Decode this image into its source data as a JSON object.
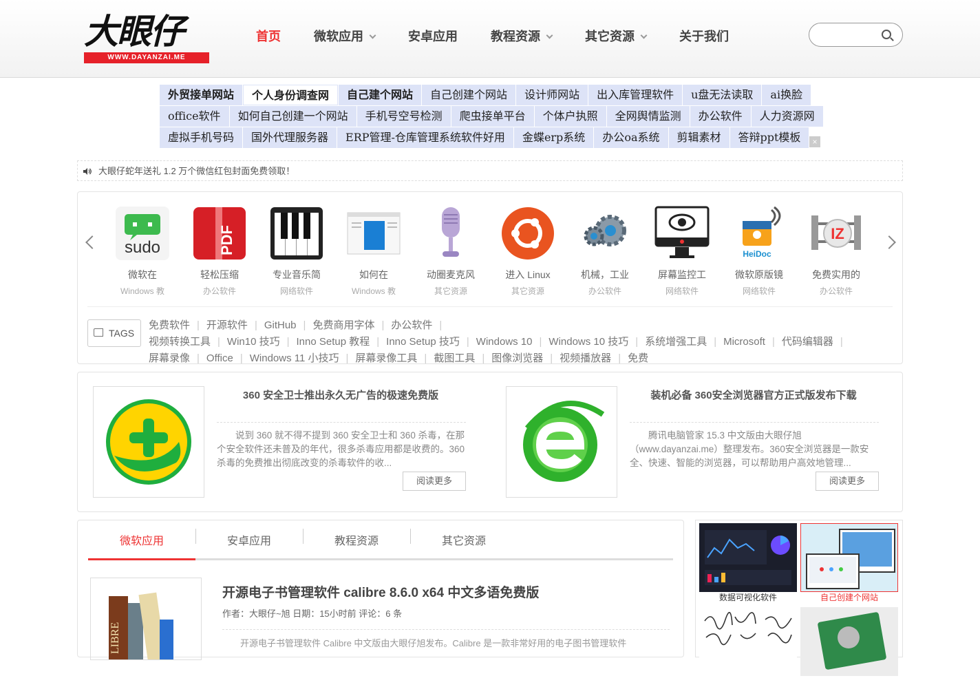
{
  "header": {
    "logo_text": "大眼仔",
    "logo_url_text": "WWW.DAYANZAI.ME",
    "nav": [
      {
        "label": "首页",
        "active": true,
        "has_menu": false
      },
      {
        "label": "微软应用",
        "active": false,
        "has_menu": true
      },
      {
        "label": "安卓应用",
        "active": false,
        "has_menu": false
      },
      {
        "label": "教程资源",
        "active": false,
        "has_menu": true
      },
      {
        "label": "其它资源",
        "active": false,
        "has_menu": true
      },
      {
        "label": "关于我们",
        "active": false,
        "has_menu": false
      }
    ],
    "search_placeholder": ""
  },
  "ad_links": {
    "rows": [
      [
        "外贸接单网站",
        "个人身份调查网",
        "自己建个网站",
        "自己创建个网站",
        "设计师网站",
        "出入库管理软件",
        "u盘无法读取",
        "ai换脸"
      ],
      [
        "office软件",
        "如何自己创建一个网站",
        "手机号空号检测",
        "爬虫接单平台",
        "个体户执照",
        "全网舆情监测",
        "办公软件",
        "人力资源网"
      ],
      [
        "虚拟手机号码",
        "国外代理服务器",
        "ERP管理-仓库管理系统软件好用",
        "金蝶erp系统",
        "办公oa系统",
        "剪辑素材",
        "答辩ppt模板"
      ]
    ],
    "close": "×"
  },
  "notice": {
    "text": "大眼仔蛇年送礼 1.2 万个微信红包封面免费领取！"
  },
  "apps": [
    {
      "title": "微软在",
      "sub": "Windows 教",
      "icon": "sudo-icon"
    },
    {
      "title": "轻松压缩",
      "sub": "办公软件",
      "icon": "pdf-zip-icon"
    },
    {
      "title": "专业音乐简",
      "sub": "网络软件",
      "icon": "piano-icon"
    },
    {
      "title": "如何在",
      "sub": "Windows 教",
      "icon": "window-icon"
    },
    {
      "title": "动圈麦克风",
      "sub": "其它资源",
      "icon": "microphone-icon"
    },
    {
      "title": "进入 Linux",
      "sub": "其它资源",
      "icon": "ubuntu-icon"
    },
    {
      "title": "机械，工业",
      "sub": "办公软件",
      "icon": "gears-icon"
    },
    {
      "title": "屏幕监控工",
      "sub": "网络软件",
      "icon": "monitor-eye-icon"
    },
    {
      "title": "微软原版镜",
      "sub": "网络软件",
      "icon": "heidoc-icon"
    },
    {
      "title": "免费实用的",
      "sub": "办公软件",
      "icon": "izarc-icon"
    }
  ],
  "tags": {
    "label": "TAGS",
    "items": [
      "免费软件",
      "开源软件",
      "GitHub",
      "免费商用字体",
      "办公软件",
      "视频转换工具",
      "Win10 技巧",
      "Inno Setup 教程",
      "Inno Setup 技巧",
      "Windows 10",
      "Windows 10 技巧",
      "系统增强工具",
      "Microsoft",
      "代码编辑器",
      "屏幕录像",
      "Office",
      "Windows 11 小技巧",
      "屏幕录像工具",
      "截图工具",
      "图像浏览器",
      "视频播放器",
      "免费"
    ]
  },
  "featured": [
    {
      "title": "360 安全卫士推出永久无广告的极速免费版",
      "desc": "说到 360 就不得不提到 360 安全卫士和 360 杀毒，在那个安全软件还未普及的年代，很多杀毒应用都是收费的。360 杀毒的免费推出彻底改变的杀毒软件的收...",
      "more": "阅读更多"
    },
    {
      "title": "装机必备 360安全浏览器官方正式版发布下载",
      "desc": "腾讯电脑管家 15.3 中文版由大眼仔旭（www.dayanzai.me）整理发布。360安全浏览器是一款安全、快速、智能的浏览器，可以帮助用户高效地管理...",
      "more": "阅读更多"
    }
  ],
  "tabs": [
    {
      "label": "微软应用",
      "active": true
    },
    {
      "label": "安卓应用",
      "active": false
    },
    {
      "label": "教程资源",
      "active": false
    },
    {
      "label": "其它资源",
      "active": false
    }
  ],
  "post": {
    "title": "开源电子书管理软件 calibre 8.6.0 x64 中文多语免费版",
    "meta": "作者：大眼仔~旭 日期：15小时前 评论：6 条",
    "desc": "开源电子书管理软件 Calibre 中文版由大眼仔旭发布。Calibre 是一款非常好用的电子图书管理软件"
  },
  "side": [
    {
      "caption": "数据可视化软件",
      "highlight": false
    },
    {
      "caption": "自己创建个网站",
      "highlight": true
    },
    {
      "caption": "",
      "highlight": false
    },
    {
      "caption": "",
      "highlight": false
    }
  ],
  "colors": {
    "accent": "#e33333",
    "ad_bg": "#dde3f7",
    "logo_red": "#e62129"
  }
}
